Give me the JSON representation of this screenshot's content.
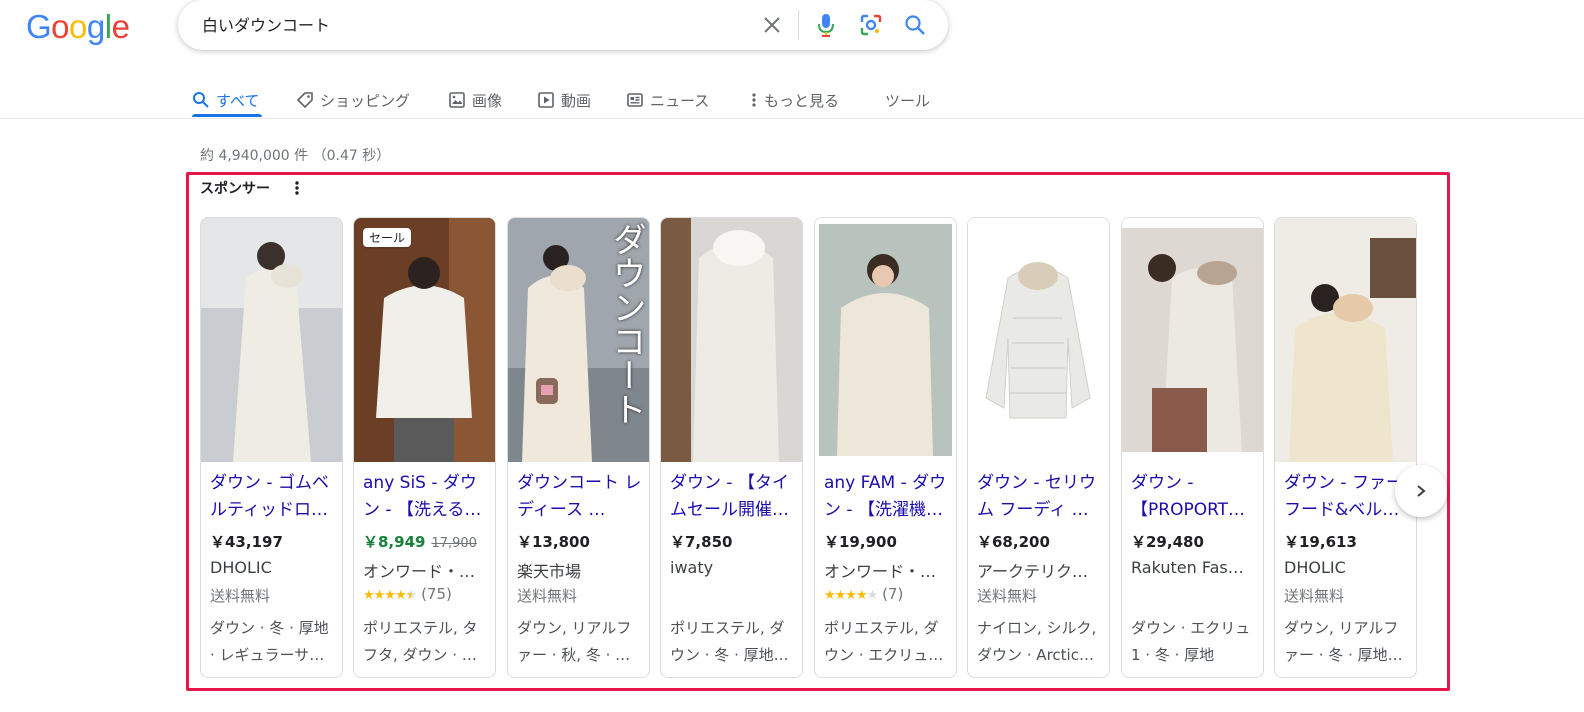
{
  "logo": "Google",
  "search": {
    "query": "白いダウンコート"
  },
  "tabs": [
    {
      "label": "すべて",
      "icon": "search-icon"
    },
    {
      "label": "ショッピング",
      "icon": "tag-icon"
    },
    {
      "label": "画像",
      "icon": "image-icon"
    },
    {
      "label": "動画",
      "icon": "play-icon"
    },
    {
      "label": "ニュース",
      "icon": "news-icon"
    },
    {
      "label": "もっと見る",
      "icon": "more-vert-icon"
    },
    {
      "label": "ツール"
    }
  ],
  "result_stats": "約 4,940,000 件 （0.47 秒）",
  "sponsored": {
    "label": "スポンサー",
    "products": [
      {
        "title": "ダウン - ゴムベルティッドロ…",
        "price": "￥43,197",
        "merchant": "DHOLIC",
        "line3": "送料無料",
        "desc": "ダウン · 冬 · 厚地 · レギュラーサ…",
        "image": "white long down coat with fur hood"
      },
      {
        "badge": "セール",
        "title": "any SiS - ダウン - 【洗える…",
        "price": "￥8,949",
        "old_price": "17,900",
        "merchant": "オンワード・…",
        "rating": "4.5",
        "reviews": "(75)",
        "desc": "ポリエステル, タフタ, ダウン · …",
        "image": "short white puffer jacket"
      },
      {
        "title": "ダウンコート レディース …",
        "price": "￥13,800",
        "merchant": "楽天市場",
        "line3": "送料無料",
        "desc": "ダウン, リアルファー · 秋, 冬 · …",
        "image_text": "ダウンコート",
        "image": "white down coat with vertical text"
      },
      {
        "title": "ダウン - 【タイムセール開催…",
        "price": "￥7,850",
        "merchant": "iwaty",
        "line3": "",
        "desc": "ポリエステル, ダウン · 冬 · 厚地…",
        "image": "long white down coat with fur hood"
      },
      {
        "title": "any FAM - ダウン - 【洗濯機…",
        "price": "￥19,900",
        "merchant": "オンワード・…",
        "rating": "4.0",
        "reviews": "(7)",
        "desc": "ポリエステル, ダウン · エクリュ…",
        "image": "white hooded down jacket"
      },
      {
        "title": "ダウン - セリウム フーディ …",
        "price": "￥68,200",
        "merchant": "アークテリク…",
        "line3": "送料無料",
        "desc": "ナイロン, シルク, ダウン · Arctic…",
        "image": "white quilted hoodie jacket"
      },
      {
        "title": "ダウン - 【PROPORT…",
        "price": "￥29,480",
        "merchant": "Rakuten Fas…",
        "line3": "",
        "desc": "ダウン · エクリュ 1 · 冬 · 厚地",
        "image": "long white down coat with fur collar"
      },
      {
        "title": "ダウン - ファーフード&ベル…",
        "price": "￥19,613",
        "merchant": "DHOLIC",
        "line3": "送料無料",
        "desc": "ダウン, リアルファー · 冬 · 厚地…",
        "image": "cream down jacket with fur hood"
      }
    ]
  },
  "colors": {
    "link": "#1a0dab",
    "accent": "#1a73e8",
    "sale_price": "#188038",
    "highlight_frame": "#e8174a",
    "star": "#fbbc04"
  }
}
